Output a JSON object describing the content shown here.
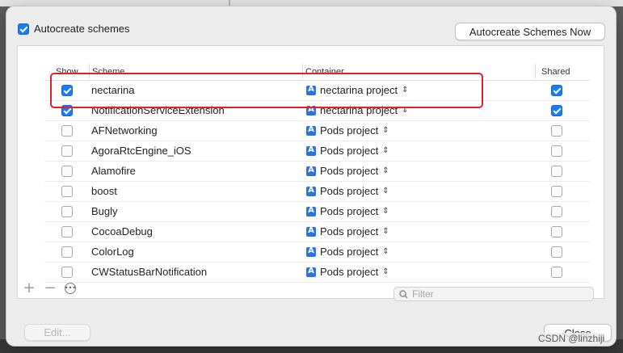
{
  "autocreate": {
    "label": "Autocreate schemes",
    "checked": true
  },
  "autocreate_now_label": "Autocreate Schemes Now",
  "table": {
    "headers": {
      "show": "Show",
      "scheme": "Scheme",
      "container": "Container",
      "shared": "Shared"
    },
    "rows": [
      {
        "show": true,
        "scheme": "nectarina",
        "container": "nectarina project",
        "shared": true
      },
      {
        "show": true,
        "scheme": "NotificationServiceExtension",
        "container": "nectarina project",
        "shared": true
      },
      {
        "show": false,
        "scheme": "AFNetworking",
        "container": "Pods project",
        "shared": false
      },
      {
        "show": false,
        "scheme": "AgoraRtcEngine_iOS",
        "container": "Pods project",
        "shared": false
      },
      {
        "show": false,
        "scheme": "Alamofire",
        "container": "Pods project",
        "shared": false
      },
      {
        "show": false,
        "scheme": "boost",
        "container": "Pods project",
        "shared": false
      },
      {
        "show": false,
        "scheme": "Bugly",
        "container": "Pods project",
        "shared": false
      },
      {
        "show": false,
        "scheme": "CocoaDebug",
        "container": "Pods project",
        "shared": false
      },
      {
        "show": false,
        "scheme": "ColorLog",
        "container": "Pods project",
        "shared": false
      },
      {
        "show": false,
        "scheme": "CWStatusBarNotification",
        "container": "Pods project",
        "shared": false
      }
    ]
  },
  "toolbar": {
    "add_icon": "plus-icon",
    "remove_icon": "minus-icon",
    "more_icon": "ellipsis-circle-icon"
  },
  "filter": {
    "placeholder": "Filter",
    "value": ""
  },
  "edit_label": "Edit...",
  "close_label": "Close",
  "watermark": "CSDN @linzhiji",
  "colors": {
    "accent": "#1a7cf5",
    "highlight": "#e0202e"
  }
}
